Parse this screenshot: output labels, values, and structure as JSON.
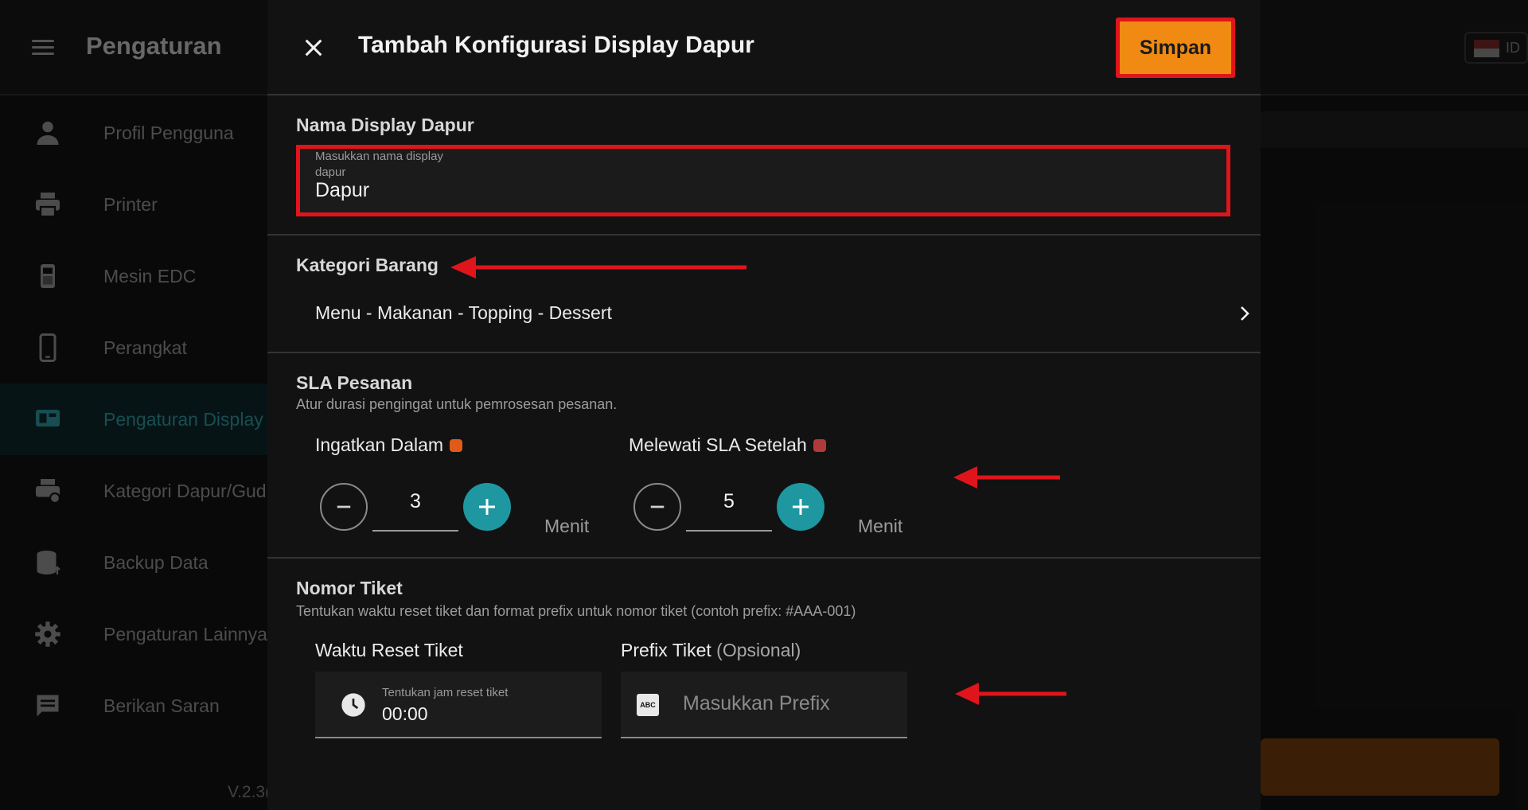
{
  "app": {
    "title": "Pengaturan",
    "language": "ID",
    "version": "V.2.3("
  },
  "sidebar": {
    "items": [
      {
        "label": "Profil Pengguna",
        "icon": "person-icon"
      },
      {
        "label": "Printer",
        "icon": "printer-icon"
      },
      {
        "label": "Mesin EDC",
        "icon": "edc-icon"
      },
      {
        "label": "Perangkat",
        "icon": "phone-icon"
      },
      {
        "label": "Pengaturan Display",
        "icon": "display-icon",
        "active": true
      },
      {
        "label": "Kategori Dapur/Gud",
        "icon": "printer-gear-icon"
      },
      {
        "label": "Backup Data",
        "icon": "database-icon"
      },
      {
        "label": "Pengaturan Lainnya",
        "icon": "gear-icon"
      },
      {
        "label": "Berikan Saran",
        "icon": "feedback-icon"
      }
    ]
  },
  "dialog": {
    "title": "Tambah Konfigurasi Display Dapur",
    "save_label": "Simpan",
    "name_section": {
      "title": "Nama Display Dapur",
      "field_label": "Masukkan nama display dapur",
      "value": "Dapur"
    },
    "category_section": {
      "title": "Kategori Barang",
      "value": "Menu - Makanan - Topping - Dessert"
    },
    "sla_section": {
      "title": "SLA Pesanan",
      "description": "Atur durasi pengingat untuk pemrosesan pesanan.",
      "remind": {
        "label": "Ingatkan Dalam",
        "value": "3",
        "unit": "Menit",
        "dot_color": "#e05a1a"
      },
      "overdue": {
        "label": "Melewati SLA Setelah",
        "value": "5",
        "unit": "Menit",
        "dot_color": "#b03a3a"
      }
    },
    "ticket_section": {
      "title": "Nomor Tiket",
      "description": "Tentukan waktu reset tiket dan format prefix untuk nomor tiket (contoh prefix: #AAA-001)",
      "reset": {
        "label": "Waktu Reset Tiket",
        "hint": "Tentukan jam reset tiket",
        "value": "00:00"
      },
      "prefix": {
        "label": "Prefix Tiket",
        "optional": "(Opsional)",
        "placeholder": "Masukkan Prefix",
        "icon_text": "ABC"
      }
    }
  },
  "colors": {
    "accent": "#1e97a1",
    "save_button": "#f08a12",
    "highlight": "#e0141b"
  }
}
